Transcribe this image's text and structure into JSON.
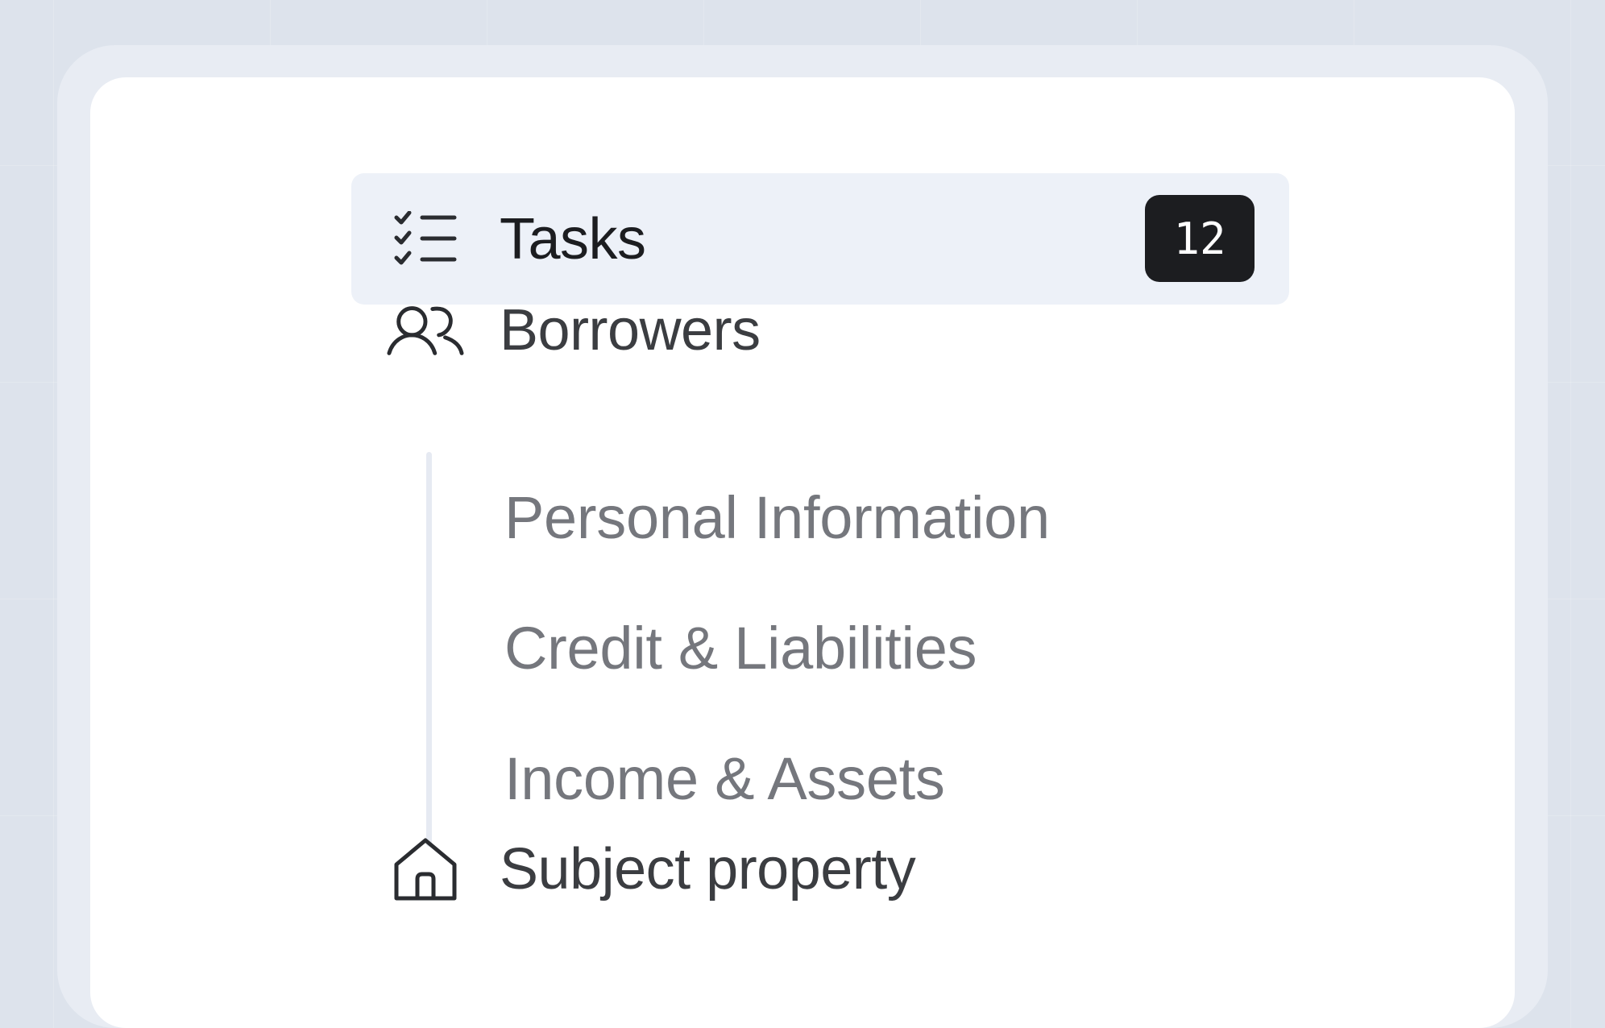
{
  "nav": {
    "items": [
      {
        "label": "Tasks",
        "icon": "checklist-icon",
        "active": true,
        "badge": "12"
      },
      {
        "label": "Borrowers",
        "icon": "users-icon",
        "active": false
      },
      {
        "label": "Subject property",
        "icon": "house-icon",
        "active": false
      }
    ],
    "sub_items": [
      {
        "label": "Personal Information"
      },
      {
        "label": "Credit & Liabilities"
      },
      {
        "label": "Income & Assets"
      }
    ]
  },
  "colors": {
    "background": "#dde3ec",
    "frame": "#e8ecf3",
    "card": "#ffffff",
    "active_item_bg": "#edf1f8",
    "badge_bg": "#1c1d20",
    "primary_text": "#1c1d20",
    "secondary_text": "#3b3d41",
    "sub_text": "#75777d"
  }
}
